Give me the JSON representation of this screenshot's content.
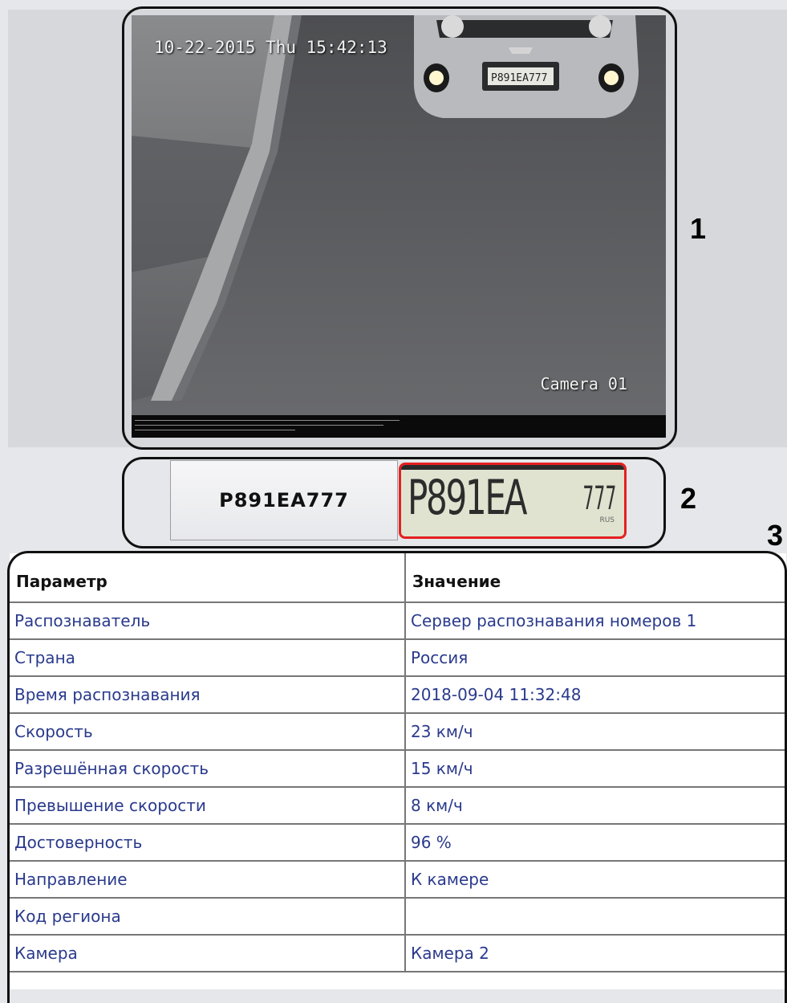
{
  "camera": {
    "timestamp": "10-22-2015 Thu 15:42:13",
    "camera_label": "Camera 01",
    "plate_on_car": "P891EA777"
  },
  "markers": {
    "frame": "1",
    "plate": "2",
    "table": "3"
  },
  "plate": {
    "recognized_text": "P891EA777",
    "image_chars": "P891EA",
    "image_region": "777",
    "image_country": "RUS"
  },
  "table": {
    "headers": [
      "Параметр",
      "Значение"
    ],
    "rows": [
      [
        "Распознаватель",
        "Сервер распознавания номеров 1"
      ],
      [
        "Страна",
        "Россия"
      ],
      [
        "Время распознавания",
        "2018-09-04 11:32:48"
      ],
      [
        "Скорость",
        "23 км/ч"
      ],
      [
        "Разрешённая скорость",
        "15 км/ч"
      ],
      [
        "Превышение скорости",
        "8 км/ч"
      ],
      [
        "Достоверность",
        "96 %"
      ],
      [
        "Направление",
        "К камере"
      ],
      [
        "Код региона",
        ""
      ],
      [
        "Камера",
        "Камера 2"
      ]
    ]
  },
  "colors": {
    "table_value_text": "#2a3a8c",
    "plate_highlight": "#e52020"
  }
}
